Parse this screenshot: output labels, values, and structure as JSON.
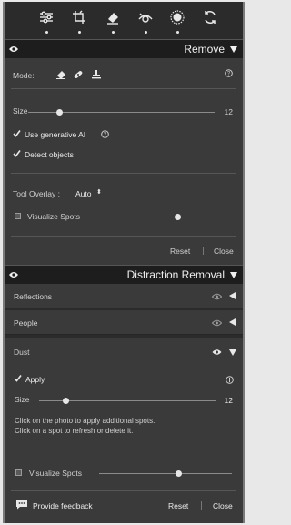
{
  "toolbar": {
    "tools": [
      {
        "icon": "sliders-icon"
      },
      {
        "icon": "crop-icon"
      },
      {
        "icon": "eraser-icon"
      },
      {
        "icon": "eye-retouch-icon"
      },
      {
        "icon": "masking-icon"
      },
      {
        "icon": "presets-icon"
      }
    ]
  },
  "remove": {
    "title": "Remove",
    "mode_label": "Mode:",
    "size_label": "Size",
    "size_value": "12",
    "size_fraction": 0.17,
    "use_gen_ai_label": "Use generative AI",
    "use_gen_ai_checked": true,
    "detect_objects_label": "Detect objects",
    "detect_objects_checked": true,
    "tool_overlay_label": "Tool Overlay :",
    "tool_overlay_value": "Auto",
    "visualize_spots_label": "Visualize Spots",
    "visualize_fraction": 0.6,
    "reset_label": "Reset",
    "close_label": "Close"
  },
  "distraction": {
    "title": "Distraction Removal",
    "sections": [
      {
        "name": "Reflections"
      },
      {
        "name": "People"
      },
      {
        "name": "Dust"
      }
    ],
    "apply_label": "Apply",
    "apply_checked": true,
    "size_label": "Size",
    "size_value": "12",
    "size_fraction": 0.15,
    "instructions": "Click on the photo to apply additional spots. Click on a spot to refresh or delete it.",
    "visualize_spots_label": "Visualize Spots",
    "visualize_fraction": 0.6,
    "feedback_label": "Provide feedback",
    "reset_label": "Reset",
    "close_label": "Close"
  },
  "colors": {
    "panel": "#3a3a3a",
    "header": "#1d1d1d",
    "text": "#d8d8d8"
  }
}
